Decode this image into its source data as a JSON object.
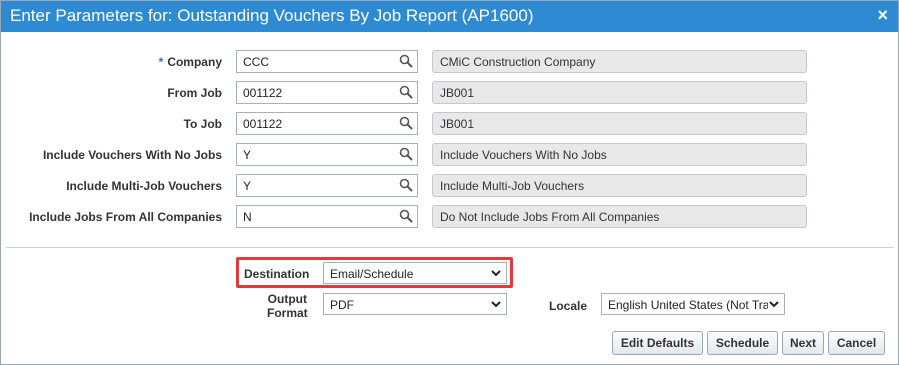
{
  "dialog": {
    "title": "Enter Parameters for: Outstanding Vouchers By Job Report (AP1600)",
    "close_glyph": "×"
  },
  "params": [
    {
      "label": "Company",
      "required": true,
      "value": "CCC",
      "description": "CMiC Construction Company"
    },
    {
      "label": "From Job",
      "required": false,
      "value": "001122",
      "description": "JB001"
    },
    {
      "label": "To Job",
      "required": false,
      "value": "001122",
      "description": "JB001"
    },
    {
      "label": "Include Vouchers With No Jobs",
      "required": false,
      "value": "Y",
      "description": "Include Vouchers With No Jobs"
    },
    {
      "label": "Include Multi-Job Vouchers",
      "required": false,
      "value": "Y",
      "description": "Include Multi-Job Vouchers"
    },
    {
      "label": "Include Jobs From All Companies",
      "required": false,
      "value": "N",
      "description": "Do Not Include Jobs From All Companies"
    }
  ],
  "required_marker": "*",
  "output": {
    "destination_label": "Destination",
    "destination_value": "Email/Schedule",
    "format_label_line1": "Output",
    "format_label_line2": "Format",
    "format_value": "PDF",
    "locale_label": "Locale",
    "locale_value": "English United States (Not Tra"
  },
  "buttons": {
    "edit_defaults": "Edit Defaults",
    "schedule": "Schedule",
    "next": "Next",
    "cancel": "Cancel"
  },
  "colors": {
    "titlebar": "#2d8ad3",
    "highlight": "#e0393e",
    "required": "#2d6fb5"
  }
}
